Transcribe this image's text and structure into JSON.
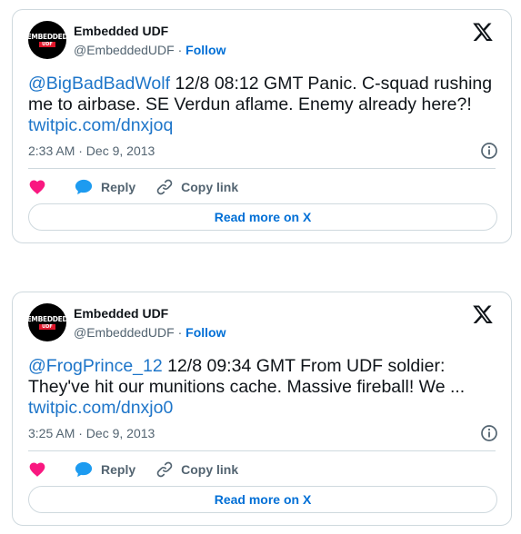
{
  "tweets": [
    {
      "author": "Embedded UDF",
      "handle": "@EmbeddedUDF",
      "separator": "·",
      "follow": "Follow",
      "avatar_line1": "EMBEDDED",
      "avatar_line2": "UDF",
      "mention": "@BigBadBadWolf",
      "text": " 12/8 08:12 GMT Panic. C-squad rushing me to airbase. SE Verdun aflame. Enemy already here?! ",
      "link": "twitpic.com/dnxjoq",
      "time": "2:33 AM · Dec 9, 2013",
      "like_icon": "heart-icon",
      "reply": "Reply",
      "copy": "Copy link",
      "read_more": "Read more on X"
    },
    {
      "author": "Embedded UDF",
      "handle": "@EmbeddedUDF",
      "separator": "·",
      "follow": "Follow",
      "avatar_line1": "EMBEDDED",
      "avatar_line2": "UDF",
      "mention": "@FrogPrince_12",
      "text": " 12/8 09:34 GMT From UDF soldier: They've hit our munitions cache. Massive fireball! We ... ",
      "link": "twitpic.com/dnxjo0",
      "time": "3:25 AM · Dec 9, 2013",
      "like_icon": "heart-icon",
      "reply": "Reply",
      "copy": "Copy link",
      "read_more": "Read more on X"
    }
  ],
  "colors": {
    "link": "#1d75c9",
    "follow": "#006fd6",
    "heart": "#f91880",
    "reply_bubble": "#1d9bf0",
    "border": "#cfd9de",
    "muted": "#536471"
  }
}
